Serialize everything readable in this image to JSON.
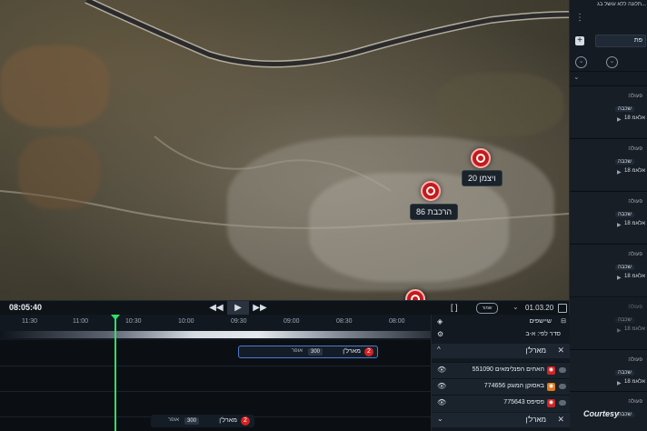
{
  "map": {
    "labels": [
      {
        "id": "weizmann",
        "text": "ויצמן 20"
      },
      {
        "id": "harakevet",
        "text": "הרכבת 86"
      }
    ]
  },
  "right_panel": {
    "title": "תלונה ללא עושל בג...",
    "tab_label": "פת",
    "cards": [
      {
        "title": "פעולה",
        "chip": "שכבה",
        "meta": "אלאמ 18"
      },
      {
        "title": "פעולה",
        "chip": "שכבה",
        "meta": "אלאמ 18"
      },
      {
        "title": "פעולה",
        "chip": "שכבה",
        "meta": "אלאמ 18"
      },
      {
        "title": "פעולה",
        "chip": "שכבה",
        "meta": "אלאמ 18"
      },
      {
        "title": "פעולה",
        "chip": "שכבה",
        "meta": "אלאמ 18"
      },
      {
        "title": "פעולה",
        "chip": "שכבה",
        "meta": "אלאמ 18"
      },
      {
        "title": "פעולה",
        "chip": "שכבה",
        "meta": "אלאמ 18"
      }
    ],
    "courtesy": "Courtesy"
  },
  "timeline": {
    "current_time": "08:05:40",
    "date": "01.03.20",
    "pill_label": "שמור",
    "ticks": [
      "11:30",
      "11:00",
      "10:30",
      "10:00",
      "09:30",
      "09:00",
      "08:30",
      "08:00"
    ],
    "events": [
      {
        "num": "2",
        "name": "מארל'ן",
        "chip": "300",
        "sub": "אופר"
      },
      {
        "num": "2",
        "name": "מארל'ן",
        "chip": "300",
        "sub": "אופר"
      }
    ]
  },
  "layers": {
    "header": "שיישפים",
    "sort_label": "סדר לפי: א-ב",
    "groups": [
      {
        "label": "מארל'ן"
      },
      {
        "label": "מארל'ן"
      }
    ],
    "rows": [
      {
        "label": "האחים הפנלימאים 551090",
        "icon_color": "#cf2525"
      },
      {
        "label": "באסוקן המוגק 774656",
        "icon_color": "#e07b1a"
      },
      {
        "label": "פסיפס 775643",
        "icon_color": "#cf2525"
      }
    ]
  }
}
